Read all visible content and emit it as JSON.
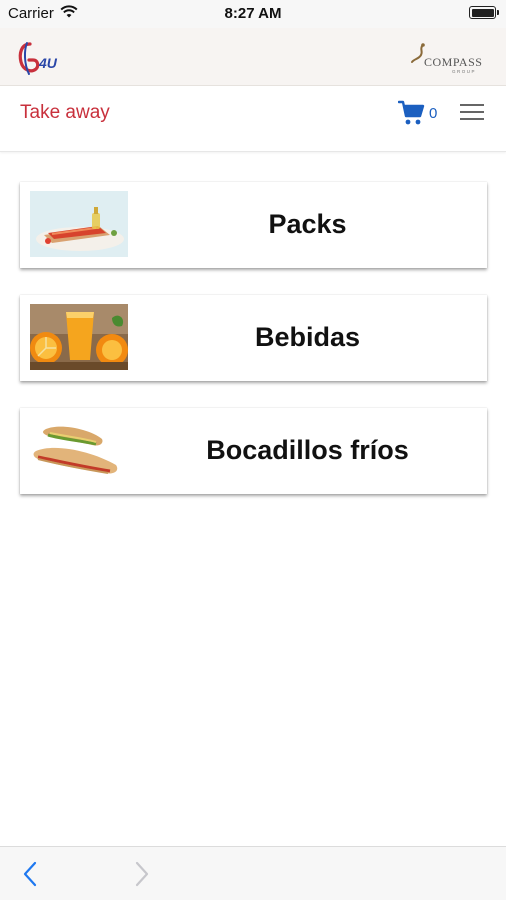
{
  "status_bar": {
    "carrier": "Carrier",
    "time": "8:27 AM"
  },
  "brand_bar": {
    "logo_left_text": "4U",
    "logo_right_text": "COMPASS",
    "logo_right_subtext": "GROUP"
  },
  "nav": {
    "title": "Take away",
    "cart_count": "0",
    "accent_color": "#c8303c",
    "cart_color": "#1b5fc0"
  },
  "categories": [
    {
      "label": "Packs",
      "icon": "toast-with-oil-image"
    },
    {
      "label": "Bebidas",
      "icon": "orange-juice-image"
    },
    {
      "label": "Bocadillos fríos",
      "icon": "sandwich-image"
    }
  ],
  "toolbar": {
    "back_icon": "chevron-left-icon",
    "forward_icon": "chevron-right-icon"
  }
}
